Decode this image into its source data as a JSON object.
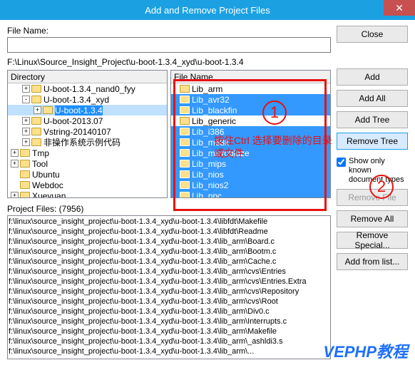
{
  "title": "Add and Remove Project Files",
  "close_x": "✕",
  "labels": {
    "fileName": "File Name:",
    "directory": "Directory",
    "fileNameCol": "File Name",
    "projectFiles": "Project Files: (7956)",
    "showOnly": "Show only known document types"
  },
  "fileNameValue": "",
  "path": "F:\\Linux\\Source_Insight_Project\\u-boot-1.3.4_xyd\\u-boot-1.3.4",
  "buttons": {
    "close": "Close",
    "add": "Add",
    "addAll": "Add All",
    "addTree": "Add Tree",
    "removeTree": "Remove Tree",
    "removeFile": "Remove File",
    "removeAll": "Remove All",
    "removeSpecial": "Remove Special...",
    "addFromList": "Add from list..."
  },
  "tree": [
    {
      "indent": 1,
      "exp": "+",
      "label": "U-boot-1.3.4_nand0_fyy"
    },
    {
      "indent": 1,
      "exp": "-",
      "label": "U-boot-1.3.4_xyd"
    },
    {
      "indent": 2,
      "exp": "+",
      "label": "U-boot-1.3.4",
      "sel": true
    },
    {
      "indent": 1,
      "exp": "+",
      "label": "U-boot-2013.07"
    },
    {
      "indent": 1,
      "exp": "+",
      "label": "Vstring-20140107"
    },
    {
      "indent": 1,
      "exp": "+",
      "label": "非操作系统示例代码"
    },
    {
      "indent": 0,
      "exp": "+",
      "label": "Tmp"
    },
    {
      "indent": 0,
      "exp": "+",
      "label": "Tool"
    },
    {
      "indent": 0,
      "exp": "",
      "label": "Ubuntu"
    },
    {
      "indent": 0,
      "exp": "",
      "label": "Webdoc"
    },
    {
      "indent": 0,
      "exp": "+",
      "label": "Xueyuan"
    }
  ],
  "files": [
    {
      "name": "Lib_arm",
      "sel": false
    },
    {
      "name": "Lib_avr32",
      "sel": true
    },
    {
      "name": "Lib_blackfin",
      "sel": true
    },
    {
      "name": "Lib_generic",
      "sel": false
    },
    {
      "name": "Lib_i386",
      "sel": true
    },
    {
      "name": "Lib_m68k",
      "sel": true
    },
    {
      "name": "Lib_microblaze",
      "sel": true
    },
    {
      "name": "Lib_mips",
      "sel": true
    },
    {
      "name": "Lib_nios",
      "sel": true
    },
    {
      "name": "Lib_nios2",
      "sel": true
    },
    {
      "name": "Lib_ppc",
      "sel": true
    }
  ],
  "projectFiles": [
    "f:\\linux\\source_insight_project\\u-boot-1.3.4_xyd\\u-boot-1.3.4\\libfdt\\Makefile",
    "f:\\linux\\source_insight_project\\u-boot-1.3.4_xyd\\u-boot-1.3.4\\libfdt\\Readme",
    "f:\\linux\\source_insight_project\\u-boot-1.3.4_xyd\\u-boot-1.3.4\\lib_arm\\Board.c",
    "f:\\linux\\source_insight_project\\u-boot-1.3.4_xyd\\u-boot-1.3.4\\lib_arm\\Bootm.c",
    "f:\\linux\\source_insight_project\\u-boot-1.3.4_xyd\\u-boot-1.3.4\\lib_arm\\Cache.c",
    "f:\\linux\\source_insight_project\\u-boot-1.3.4_xyd\\u-boot-1.3.4\\lib_arm\\cvs\\Entries",
    "f:\\linux\\source_insight_project\\u-boot-1.3.4_xyd\\u-boot-1.3.4\\lib_arm\\cvs\\Entries.Extra",
    "f:\\linux\\source_insight_project\\u-boot-1.3.4_xyd\\u-boot-1.3.4\\lib_arm\\cvs\\Repository",
    "f:\\linux\\source_insight_project\\u-boot-1.3.4_xyd\\u-boot-1.3.4\\lib_arm\\cvs\\Root",
    "f:\\linux\\source_insight_project\\u-boot-1.3.4_xyd\\u-boot-1.3.4\\lib_arm\\Div0.c",
    "f:\\linux\\source_insight_project\\u-boot-1.3.4_xyd\\u-boot-1.3.4\\lib_arm\\Interrupts.c",
    "f:\\linux\\source_insight_project\\u-boot-1.3.4_xyd\\u-boot-1.3.4\\lib_arm\\Makefile",
    "f:\\linux\\source_insight_project\\u-boot-1.3.4_xyd\\u-boot-1.3.4\\lib_arm\\_ashldi3.s",
    "f:\\linux\\source_insight_project\\u-boot-1.3.4_xyd\\u-boot-1.3.4\\lib_arm\\..."
  ],
  "annotations": {
    "circle1": "1",
    "circle2": "2",
    "hint": "按住Ctrl 选择要删除的目录或文件",
    "watermark": "VEPHP教程"
  }
}
